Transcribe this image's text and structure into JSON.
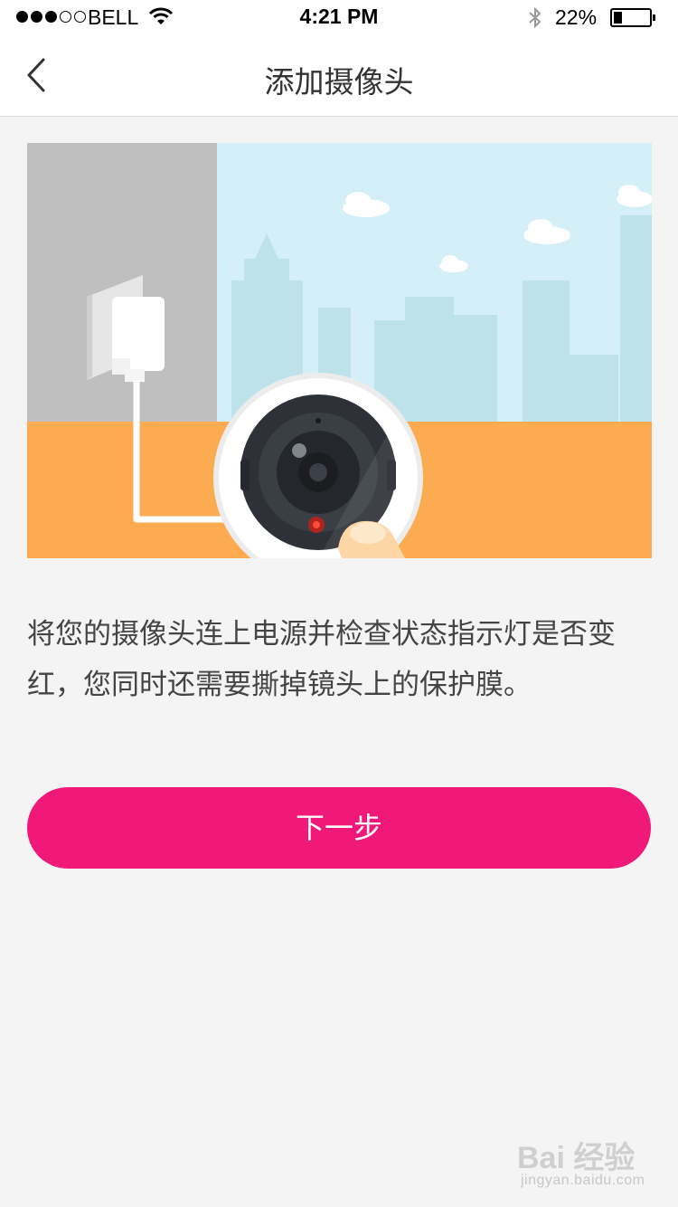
{
  "status_bar": {
    "carrier": "BELL",
    "time": "4:21 PM",
    "battery": "22%",
    "battery_level": 0.22,
    "signal_bars_filled": 3,
    "signal_bars_total": 5
  },
  "nav": {
    "title": "添加摄像头",
    "back_icon": "chevron-left-icon"
  },
  "instruction": "将您的摄像头连上电源并检查状态指示灯是否变红，您同时还需要撕掉镜头上的保护膜。",
  "next_button": "下一步",
  "watermark": {
    "brand": "Bai 经验",
    "site": "jingyan.baidu.com"
  },
  "colors": {
    "accent": "#f0197a",
    "floor": "#fdab51",
    "sky": "#d4eff7",
    "wall": "#bfbfbf"
  }
}
